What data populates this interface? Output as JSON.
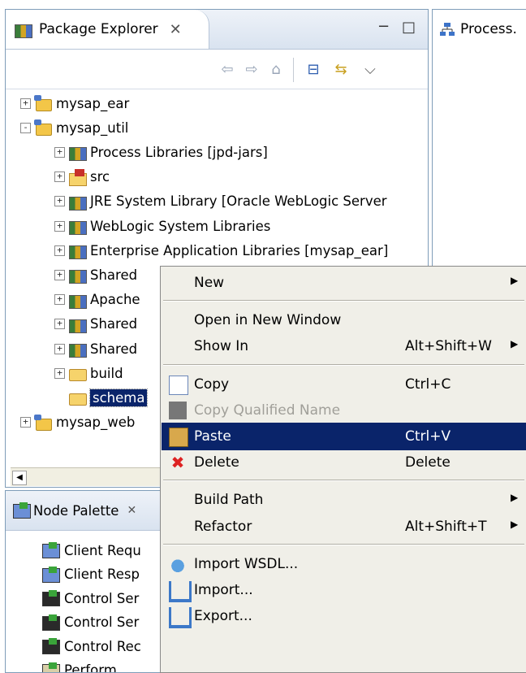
{
  "package_explorer": {
    "tab_title": "Package Explorer",
    "tree": [
      {
        "label": "mysap_ear",
        "exp": "+",
        "icon": "proj",
        "level": 0
      },
      {
        "label": "mysap_util",
        "exp": "-",
        "icon": "proj",
        "level": 0
      },
      {
        "label": "Process Libraries [jpd-jars]",
        "exp": "+",
        "icon": "lib",
        "level": 1
      },
      {
        "label": "src",
        "exp": "+",
        "icon": "src",
        "level": 1
      },
      {
        "label": "JRE System Library [Oracle WebLogic Server",
        "exp": "+",
        "icon": "lib",
        "level": 1
      },
      {
        "label": "WebLogic System Libraries",
        "exp": "+",
        "icon": "lib",
        "level": 1
      },
      {
        "label": "Enterprise Application Libraries [mysap_ear]",
        "exp": "+",
        "icon": "lib",
        "level": 1
      },
      {
        "label": "Shared",
        "exp": "+",
        "icon": "lib",
        "level": 1
      },
      {
        "label": "Apache",
        "exp": "+",
        "icon": "lib",
        "level": 1
      },
      {
        "label": "Shared",
        "exp": "+",
        "icon": "lib",
        "level": 1
      },
      {
        "label": "Shared",
        "exp": "+",
        "icon": "lib",
        "level": 1
      },
      {
        "label": "build",
        "exp": "+",
        "icon": "fold",
        "level": 1
      },
      {
        "label": "schema",
        "exp": "",
        "icon": "fold",
        "level": 1,
        "selected": true
      },
      {
        "label": "mysap_web",
        "exp": "+",
        "icon": "proj",
        "level": 0
      }
    ]
  },
  "process_view": {
    "tab_title": "Process."
  },
  "node_palette": {
    "tab_title": "Node Palette",
    "items": [
      {
        "label": "Client Requ",
        "icon": "blue"
      },
      {
        "label": "Client Resp",
        "icon": "blue"
      },
      {
        "label": "Control Ser",
        "icon": "dark"
      },
      {
        "label": "Control Ser",
        "icon": "dark"
      },
      {
        "label": "Control Rec",
        "icon": "dark"
      },
      {
        "label": "Perform",
        "icon": "perf"
      }
    ]
  },
  "context_menu": {
    "items": [
      {
        "type": "item",
        "label": "New",
        "submenu": true
      },
      {
        "type": "sep"
      },
      {
        "type": "item",
        "label": "Open in New Window"
      },
      {
        "type": "item",
        "label": "Show In",
        "accel": "Alt+Shift+W",
        "submenu": true
      },
      {
        "type": "sep"
      },
      {
        "type": "item",
        "label": "Copy",
        "accel": "Ctrl+C",
        "icon": "copy"
      },
      {
        "type": "item",
        "label": "Copy Qualified Name",
        "icon": "copyq",
        "disabled": true
      },
      {
        "type": "item",
        "label": "Paste",
        "accel": "Ctrl+V",
        "icon": "paste",
        "highlighted": true
      },
      {
        "type": "item",
        "label": "Delete",
        "accel": "Delete",
        "icon": "delete"
      },
      {
        "type": "sep"
      },
      {
        "type": "item",
        "label": "Build Path",
        "submenu": true
      },
      {
        "type": "item",
        "label": "Refactor",
        "accel": "Alt+Shift+T",
        "submenu": true
      },
      {
        "type": "sep"
      },
      {
        "type": "item",
        "label": "Import WSDL...",
        "icon": "wsdl"
      },
      {
        "type": "item",
        "label": "Import...",
        "icon": "import"
      },
      {
        "type": "item",
        "label": "Export...",
        "icon": "export"
      }
    ]
  },
  "glyphs": {
    "close": "✕",
    "minimize": "−",
    "maximize": "□",
    "back": "⇦",
    "forward": "⇨",
    "collapse": "⊟",
    "sync": "⇆",
    "menu": "⌵",
    "submenu_arrow": "▶",
    "scroll_left": "◀",
    "delete_x": "✖",
    "palette_close": "✕"
  }
}
